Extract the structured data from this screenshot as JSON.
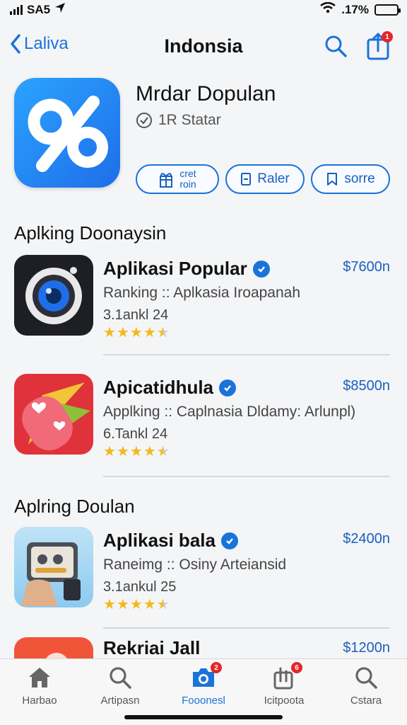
{
  "status_bar": {
    "carrier": "SA5",
    "battery": ".17%"
  },
  "nav": {
    "back_label": "Laliva",
    "title": "Indonsia",
    "share_badge": "1"
  },
  "header": {
    "title": "Mrdar Dopulan",
    "rating": "1R Statar",
    "actions": [
      {
        "label": "cret\nroin",
        "icon": "gift-icon"
      },
      {
        "label": "Raler",
        "icon": "square-icon"
      },
      {
        "label": "sorre",
        "icon": "bookmark-icon"
      }
    ]
  },
  "sections": [
    {
      "title": "Aplking Doonaysin"
    },
    {
      "title": "Aplring Doulan"
    }
  ],
  "apps": [
    {
      "name": "Aplikasi Popular",
      "price": "$7600n",
      "subtitle": "Ranking :: Aplkasia Iroapanah",
      "meta": "3.1ankl 24",
      "rating": 4.5,
      "verified": true,
      "icon": "camera-app-icon"
    },
    {
      "name": "Apicatidhula",
      "price": "$8500n",
      "subtitle": "Applking :: Caplnasia Dldamy: Arlunpl)",
      "meta": "6.Tankl 24",
      "rating": 4.5,
      "verified": true,
      "icon": "hearts-app-icon"
    },
    {
      "name": "Aplikasi bala",
      "price": "$2400n",
      "subtitle": "Raneimg :: Osiny Arteiansid",
      "meta": "3.1ankul 25",
      "rating": 4.5,
      "verified": true,
      "icon": "gadget-app-icon"
    },
    {
      "name": "Rekriai Jall",
      "price": "$1200n",
      "subtitle": "",
      "meta": "",
      "rating": 0,
      "verified": false,
      "icon": "red-app-icon"
    }
  ],
  "tabs": [
    {
      "label": "Harbao",
      "icon": "home-icon",
      "active": false,
      "badge": ""
    },
    {
      "label": "Artipasn",
      "icon": "search-icon",
      "active": false,
      "badge": ""
    },
    {
      "label": "Fooonesl",
      "icon": "camera-icon",
      "active": true,
      "badge": "2"
    },
    {
      "label": "Icitpoota",
      "icon": "apps-icon",
      "active": false,
      "badge": "6"
    },
    {
      "label": "Cstara",
      "icon": "search-icon",
      "active": false,
      "badge": ""
    }
  ],
  "colors": {
    "accent": "#1a73d9",
    "star": "#f3b91a",
    "badge": "#e5252a"
  }
}
